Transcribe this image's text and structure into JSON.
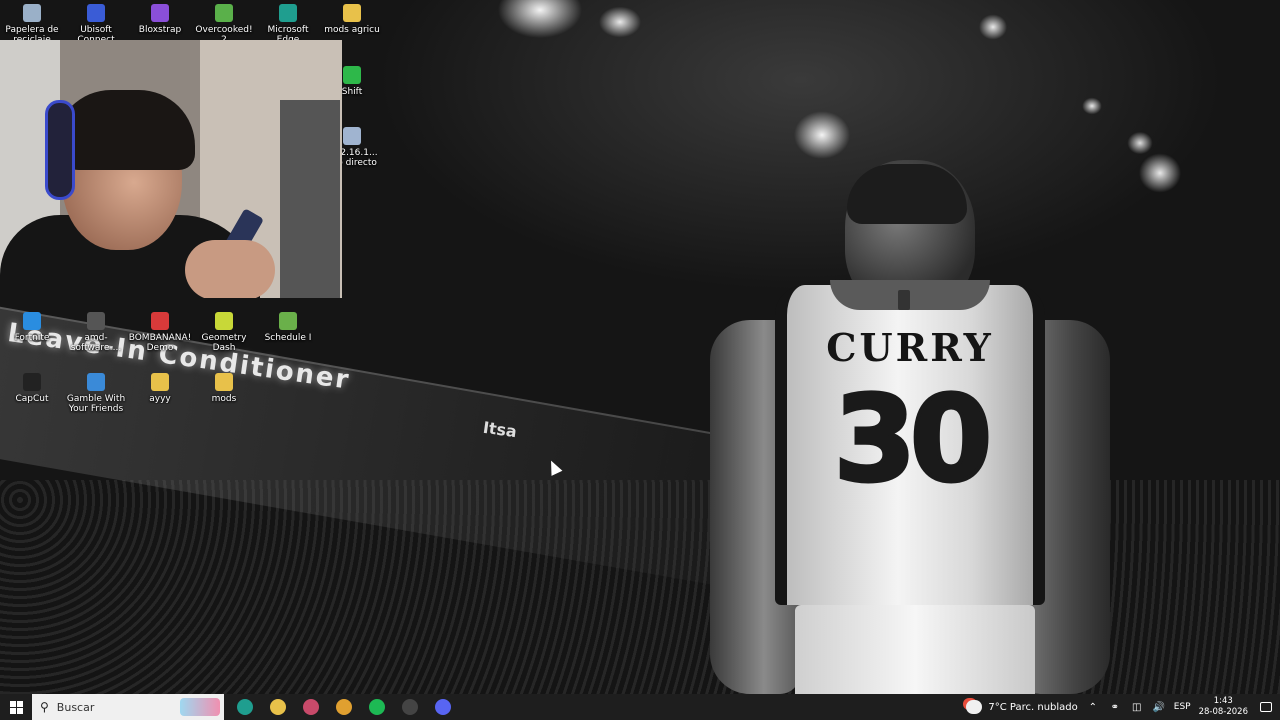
{
  "desktop": {
    "icons": [
      {
        "label": "Papelera de reciclaje",
        "icon": "recycle-bin-icon",
        "color": "#9ab0c8"
      },
      {
        "label": "Ubisoft Connect",
        "icon": "ubisoft-icon",
        "color": "#3a5cd6"
      },
      {
        "label": "Bloxstrap",
        "icon": "bloxstrap-icon",
        "color": "#8a4fd8"
      },
      {
        "label": "Overcooked! 2",
        "icon": "overcooked-icon",
        "color": "#5ab04a"
      },
      {
        "label": "Microsoft Edge",
        "icon": "edge-icon",
        "color": "#1f9e8f"
      },
      {
        "label": "mods agricu",
        "icon": "folder-icon",
        "color": "#e8c14a"
      },
      {
        "label": "Shift",
        "icon": "shift-icon",
        "color": "#2eb84a"
      },
      {
        "label": "ify-2.16.1... eso directo",
        "icon": "shortcut-icon",
        "color": "#a0b4d0"
      },
      {
        "label": "Fortnite",
        "icon": "fortnite-icon",
        "color": "#2a8de0"
      },
      {
        "label": "amd-software-...",
        "icon": "amd-icon",
        "color": "#555555"
      },
      {
        "label": "BOMBANANA! Demo",
        "icon": "bombanana-icon",
        "color": "#d83a3a"
      },
      {
        "label": "Geometry Dash",
        "icon": "geometry-dash-icon",
        "color": "#c8d838"
      },
      {
        "label": "Schedule I",
        "icon": "schedule-icon",
        "color": "#6ab04a"
      },
      {
        "label": "CapCut",
        "icon": "capcut-icon",
        "color": "#222222"
      },
      {
        "label": "Gamble With Your Friends",
        "icon": "gamble-icon",
        "color": "#3a8ad8"
      },
      {
        "label": "ayyy",
        "icon": "folder-icon",
        "color": "#e8c14a"
      },
      {
        "label": "mods",
        "icon": "folder-icon",
        "color": "#e8c14a"
      }
    ]
  },
  "wallpaper": {
    "banner_text": "Leave-In Conditioner",
    "banner_small": "Itsa",
    "jersey_name": "CURRY",
    "jersey_number": "30"
  },
  "taskbar": {
    "search_placeholder": "Buscar",
    "apps": [
      {
        "name": "Edge",
        "icon": "edge-icon",
        "color": "#1f9e8f"
      },
      {
        "name": "File Explorer",
        "icon": "folder-icon",
        "color": "#e8c14a"
      },
      {
        "name": "Snip",
        "icon": "snip-icon",
        "color": "#c84a6a"
      },
      {
        "name": "Chrome",
        "icon": "chrome-icon",
        "color": "#e0a030"
      },
      {
        "name": "Spotify",
        "icon": "spotify-icon",
        "color": "#1db954"
      },
      {
        "name": "OBS",
        "icon": "obs-icon",
        "color": "#444444"
      },
      {
        "name": "Discord",
        "icon": "discord-icon",
        "color": "#5865f2"
      }
    ],
    "weather": "7°C  Parc. nublado",
    "language": "ESP",
    "time": "1:43",
    "date": "28-08-2026"
  }
}
